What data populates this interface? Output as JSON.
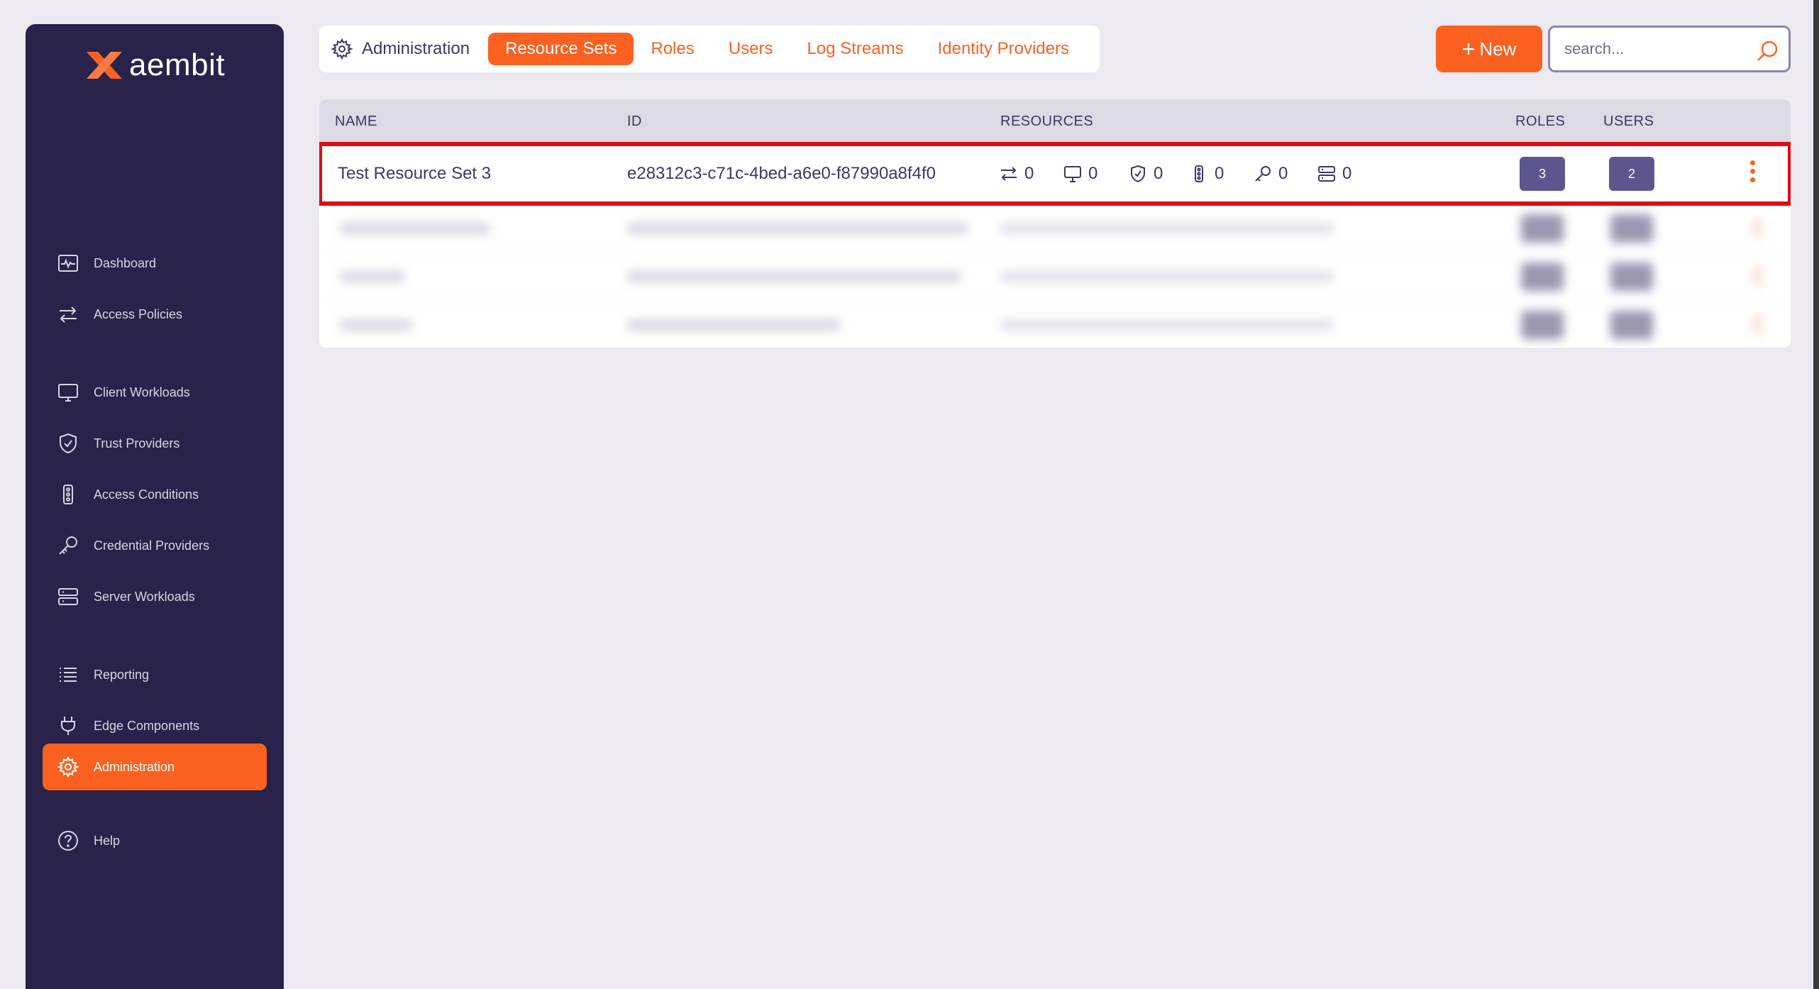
{
  "app": {
    "brand": "aembit"
  },
  "sidebar": {
    "items": [
      {
        "label": "Dashboard",
        "icon": "pulse-icon"
      },
      {
        "label": "Access Policies",
        "icon": "arrows-icon"
      },
      {
        "label": "Client Workloads",
        "icon": "monitor-icon"
      },
      {
        "label": "Trust Providers",
        "icon": "shield-check-icon"
      },
      {
        "label": "Access Conditions",
        "icon": "traffic-light-icon"
      },
      {
        "label": "Credential Providers",
        "icon": "key-icon"
      },
      {
        "label": "Server Workloads",
        "icon": "server-icon"
      },
      {
        "label": "Reporting",
        "icon": "list-icon"
      },
      {
        "label": "Edge Components",
        "icon": "plug-icon"
      },
      {
        "label": "Administration",
        "icon": "gear-icon",
        "active": true
      },
      {
        "label": "Help",
        "icon": "help-circle-icon"
      }
    ]
  },
  "tabs": {
    "section": "Administration",
    "items": [
      {
        "label": "Resource Sets",
        "active": true
      },
      {
        "label": "Roles"
      },
      {
        "label": "Users"
      },
      {
        "label": "Log Streams"
      },
      {
        "label": "Identity Providers"
      }
    ]
  },
  "toolbar": {
    "new_label": "New",
    "search_placeholder": "search..."
  },
  "table": {
    "columns": [
      "NAME",
      "ID",
      "RESOURCES",
      "ROLES",
      "USERS"
    ],
    "rows": [
      {
        "name": "Test Resource Set 3",
        "id": "e28312c3-c71c-4bed-a6e0-f87990a8f4f0",
        "resources": {
          "access_policies": "0",
          "client_workloads": "0",
          "trust_providers": "0",
          "access_conditions": "0",
          "credential_providers": "0",
          "server_workloads": "0"
        },
        "roles": "3",
        "users": "2"
      }
    ]
  },
  "colors": {
    "accent": "#fa6121",
    "sidebar_bg": "#29224a",
    "highlight": "#e00b14",
    "badge": "#5d558e"
  }
}
